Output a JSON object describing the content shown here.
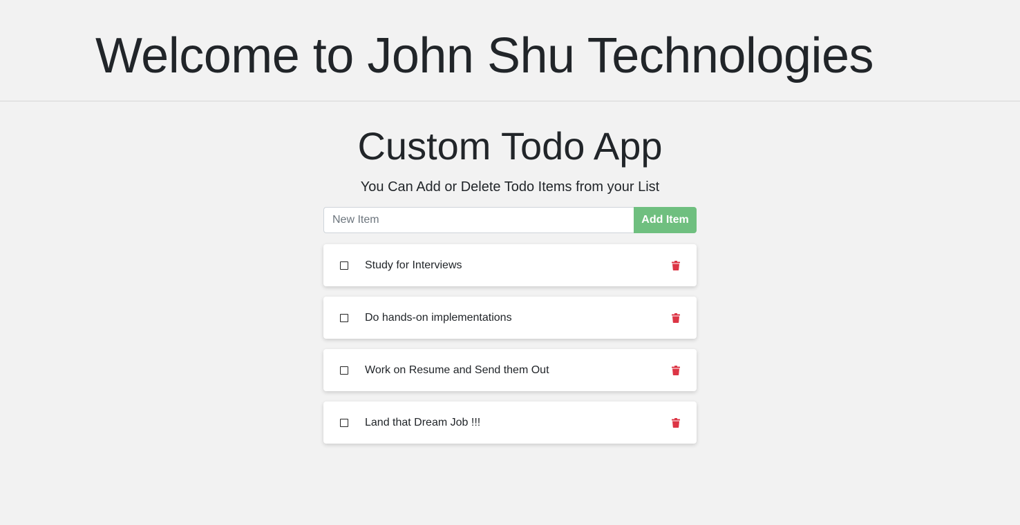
{
  "header": {
    "title": "Welcome to John Shu Technologies"
  },
  "app": {
    "title": "Custom Todo App",
    "subtitle": "You Can Add or Delete Todo Items from your List"
  },
  "add_form": {
    "input_value": "",
    "input_placeholder": "New Item",
    "button_label": "Add Item",
    "button_color": "#6fbf7f"
  },
  "todos": [
    {
      "text": "Study for Interviews",
      "checked": false
    },
    {
      "text": "Do hands-on implementations",
      "checked": false
    },
    {
      "text": "Work on Resume and Send them Out",
      "checked": false
    },
    {
      "text": "Land that Dream Job !!!",
      "checked": false
    }
  ],
  "icons": {
    "delete": "trash-icon",
    "delete_color": "#dc3545"
  }
}
